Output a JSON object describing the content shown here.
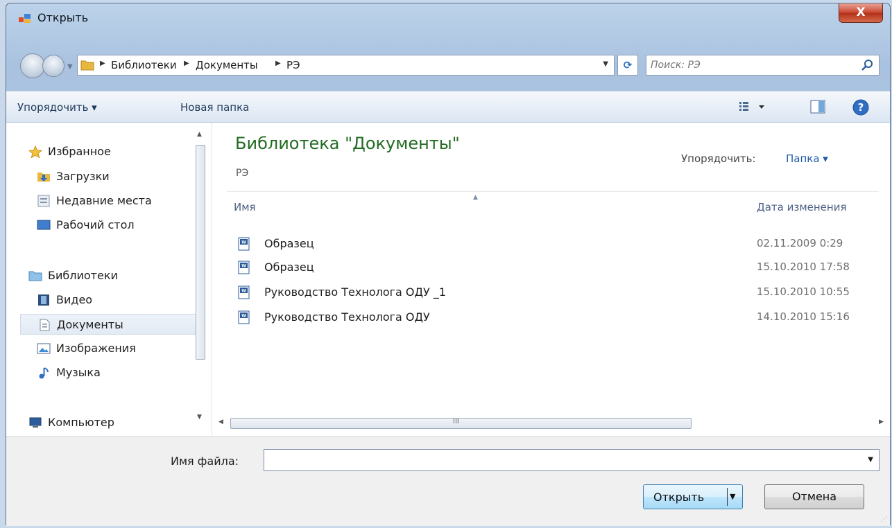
{
  "window": {
    "title": "Открыть",
    "close_label": "X"
  },
  "navigation": {
    "breadcrumbs": [
      "Библиотеки",
      "Документы",
      "РЭ"
    ],
    "search_placeholder": "Поиск: РЭ"
  },
  "toolbar": {
    "organize_label": "Упорядочить ▾",
    "new_folder_label": "Новая папка"
  },
  "sidebar": {
    "favorites": {
      "label": "Избранное",
      "items": [
        "Загрузки",
        "Недавние места",
        "Рабочий стол"
      ]
    },
    "libraries": {
      "label": "Библиотеки",
      "items": [
        "Видео",
        "Документы",
        "Изображения",
        "Музыка"
      ],
      "selected": "Документы"
    },
    "computer": {
      "label": "Компьютер"
    }
  },
  "content": {
    "library_title": "Библиотека \"Документы\"",
    "library_subtitle": "РЭ",
    "arrange_label": "Упорядочить:",
    "arrange_value": "Папка ▾",
    "columns": {
      "name": "Имя",
      "date": "Дата изменения"
    },
    "files": [
      {
        "name": "Образец",
        "date": "02.11.2009 0:29"
      },
      {
        "name": "Образец",
        "date": "15.10.2010 17:58"
      },
      {
        "name": "Руководство Технолога ОДУ _1",
        "date": "15.10.2010 10:55"
      },
      {
        "name": "Руководство Технолога ОДУ",
        "date": "14.10.2010 15:16"
      }
    ],
    "scroll_grip": "III"
  },
  "footer": {
    "filename_label": "Имя файла:",
    "filename_value": "",
    "open_label": "Открыть",
    "cancel_label": "Отмена"
  },
  "colors": {
    "library_title": "#226b22",
    "column_header": "#4d6185",
    "link_blue": "#1e5aa8"
  }
}
